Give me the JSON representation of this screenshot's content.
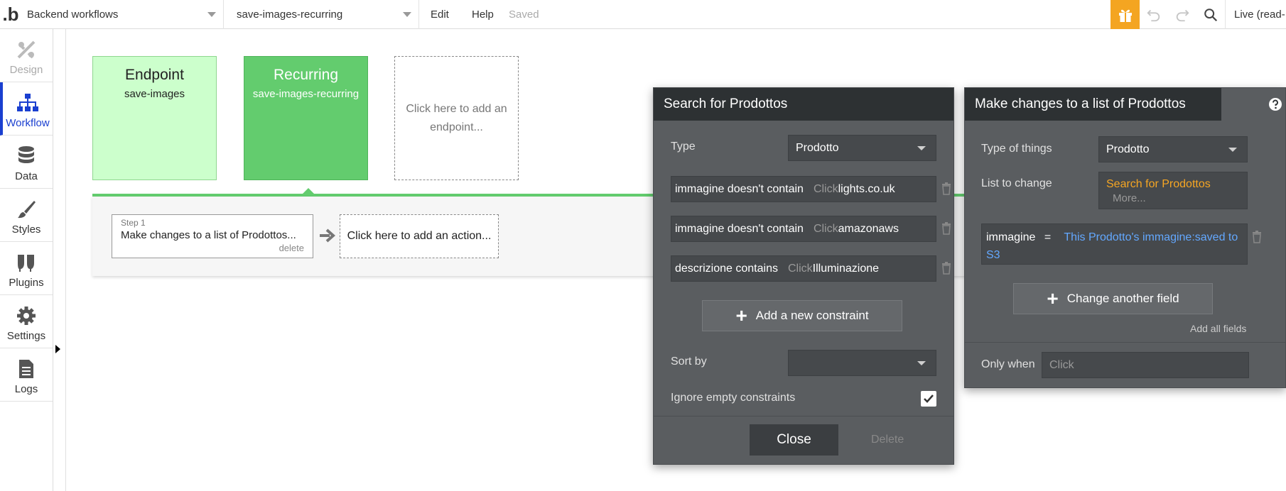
{
  "topbar": {
    "logo": ".b",
    "page_select": "Backend workflows",
    "workflow_select": "save-images-recurring",
    "menu_edit": "Edit",
    "menu_help": "Help",
    "saved_status": "Saved",
    "live": "Live (read-",
    "gift_color": "#f4a521"
  },
  "sidebar": {
    "items": [
      {
        "label": "Design",
        "icon": "design-icon"
      },
      {
        "label": "Workflow",
        "icon": "workflow-icon"
      },
      {
        "label": "Data",
        "icon": "database-icon"
      },
      {
        "label": "Styles",
        "icon": "brush-icon"
      },
      {
        "label": "Plugins",
        "icon": "plug-icon"
      },
      {
        "label": "Settings",
        "icon": "gear-icon"
      },
      {
        "label": "Logs",
        "icon": "document-icon"
      }
    ],
    "active_color": "#1a3fd0"
  },
  "canvas": {
    "endpoint": {
      "title": "Endpoint",
      "name": "save-images"
    },
    "recurring": {
      "title": "Recurring",
      "name": "save-images-recurring"
    },
    "add_endpoint": "Click here to add an endpoint...",
    "step1": {
      "label": "Step 1",
      "text": "Make changes to a list of Prodottos...",
      "delete": "delete"
    },
    "add_action": "Click here to add an action..."
  },
  "search_panel": {
    "title": "Search for Prodottos",
    "type_label": "Type",
    "type_value": "Prodotto",
    "constraints": [
      {
        "field": "immagine doesn't contain",
        "click": "Click",
        "value": "lights.co.uk"
      },
      {
        "field": "immagine doesn't contain",
        "click": "Click",
        "value": "amazonaws"
      },
      {
        "field": "descrizione contains",
        "click": "Click",
        "value": "Illuminazione"
      }
    ],
    "add_constraint": "Add a new constraint",
    "sort_label": "Sort by",
    "sort_value": "",
    "ignore_label": "Ignore empty constraints",
    "close": "Close",
    "delete": "Delete"
  },
  "changes_panel": {
    "title": "Make changes to a list of Prodottos",
    "type_label": "Type of things",
    "type_value": "Prodotto",
    "list_label": "List to change",
    "list_value": "Search for Prodottos",
    "list_more": "More...",
    "field_name": "immagine",
    "field_eq": "=",
    "field_value_line1": "This Prodotto's immagine:saved to",
    "field_value_line2": "S3",
    "change_field": "Change another field",
    "add_all": "Add all fields",
    "only_when_label": "Only when",
    "only_when_value": "Click"
  }
}
